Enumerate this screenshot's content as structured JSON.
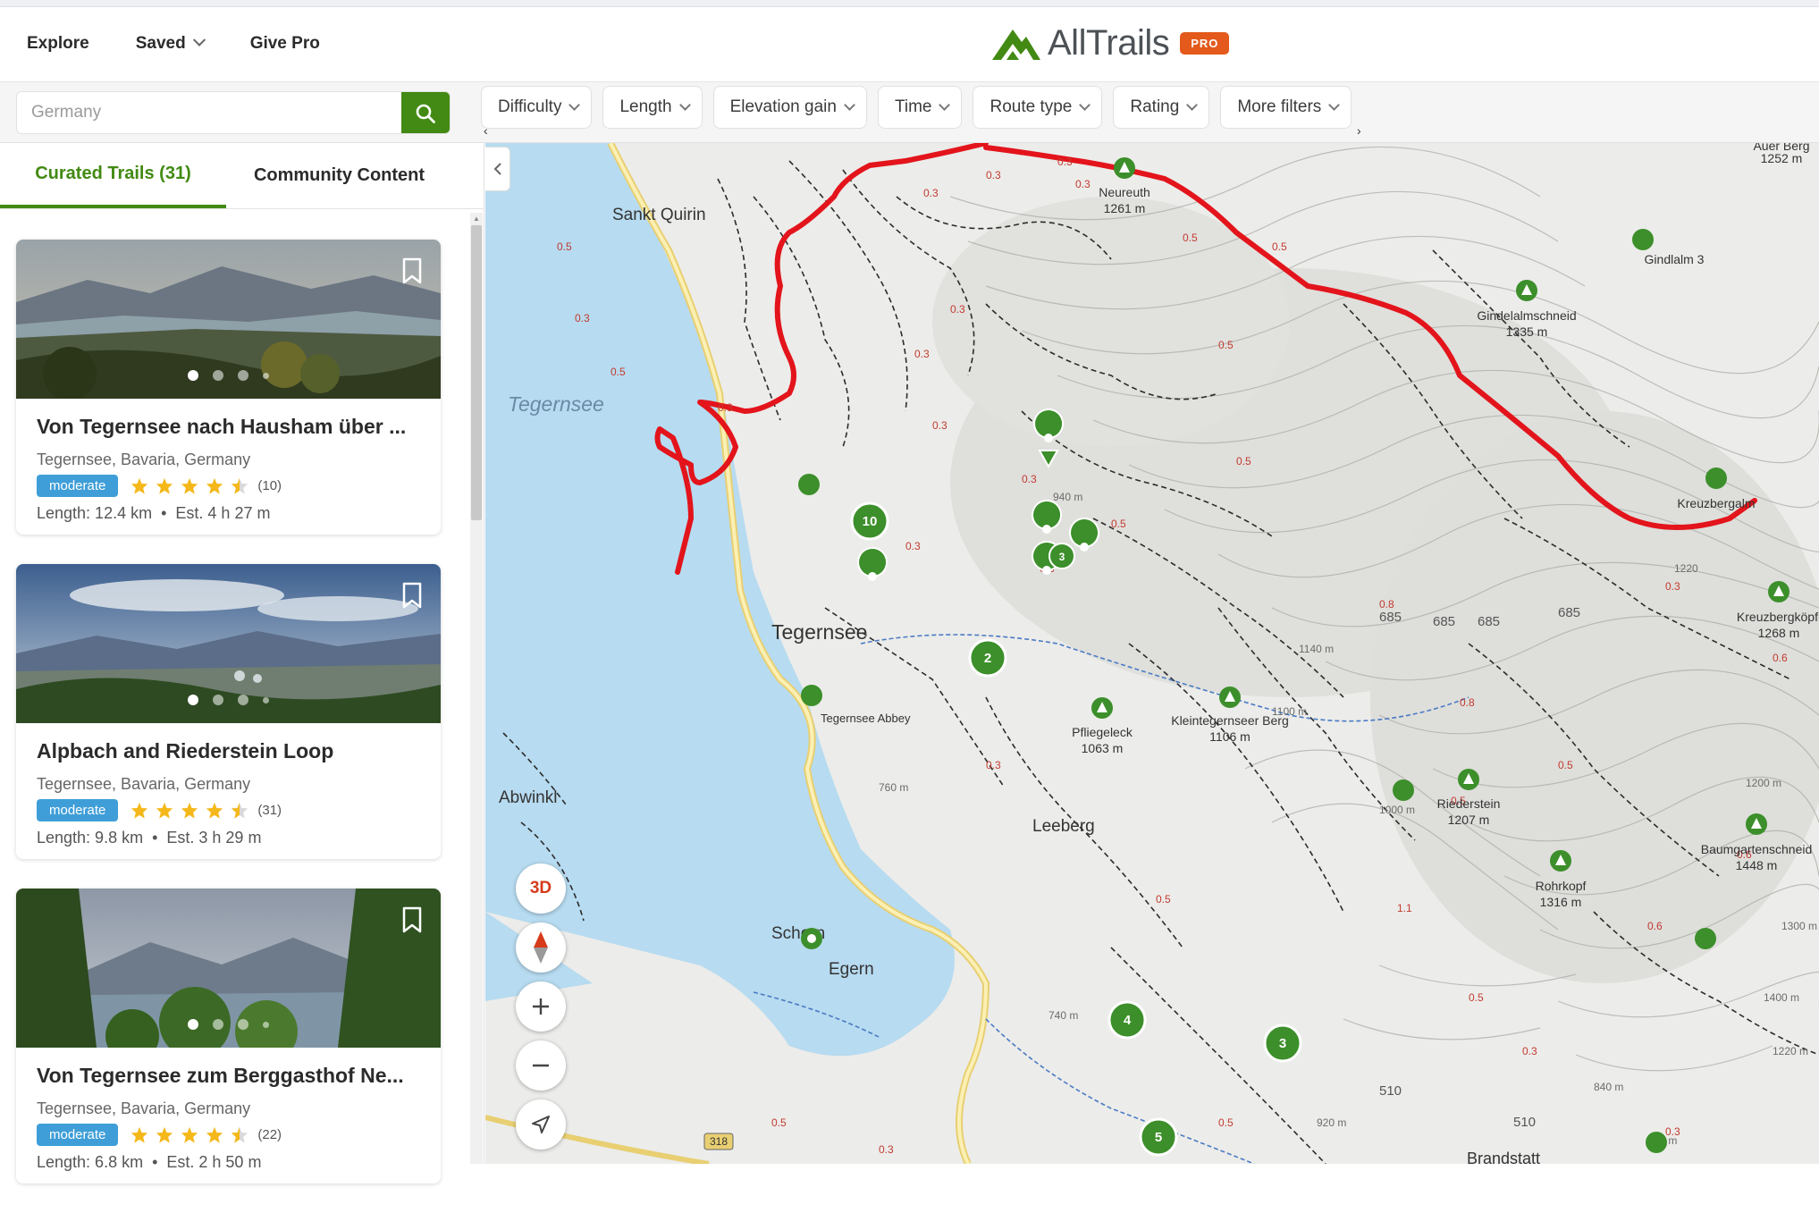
{
  "header": {
    "nav": [
      {
        "label": "Explore",
        "has_dropdown": false
      },
      {
        "label": "Saved",
        "has_dropdown": true
      },
      {
        "label": "Give Pro",
        "has_dropdown": false
      }
    ],
    "logo_text": "AllTrails",
    "pro_badge": "PRO"
  },
  "search": {
    "placeholder": "Germany"
  },
  "filters": [
    "Difficulty",
    "Length",
    "Elevation gain",
    "Time",
    "Route type",
    "Rating",
    "More filters"
  ],
  "tabs": [
    {
      "label": "Curated Trails (31)",
      "active": true
    },
    {
      "label": "Community Content",
      "active": false
    }
  ],
  "trails": [
    {
      "title": "Von Tegernsee nach Hausham über ...",
      "location": "Tegernsee, Bavaria, Germany",
      "difficulty": "moderate",
      "rating": 4.5,
      "reviews": "(10)",
      "length": "Length: 12.4 km",
      "time": "Est. 4 h 27 m"
    },
    {
      "title": "Alpbach and Riederstein Loop",
      "location": "Tegernsee, Bavaria, Germany",
      "difficulty": "moderate",
      "rating": 4.5,
      "reviews": "(31)",
      "length": "Length: 9.8 km",
      "time": "Est. 3 h 29 m"
    },
    {
      "title": "Von Tegernsee zum Berggasthof Ne...",
      "location": "Tegernsee, Bavaria, Germany",
      "difficulty": "moderate",
      "rating": 4.5,
      "reviews": "(22)",
      "length": "Length: 6.8 km",
      "time": "Est. 2 h 50 m"
    }
  ],
  "map": {
    "places": [
      "Sankt Quirin",
      "Tegernsee",
      "Tegernsee",
      "Tegernsee Abbey",
      "Abwinkl",
      "Leeberg",
      "Schorn",
      "Egern",
      "Brandstatt"
    ],
    "peaks": [
      {
        "name": "Neureuth",
        "elev": "1261 m"
      },
      {
        "name": "Gindelalmschneid",
        "elev": "1335 m"
      },
      {
        "name": "Gindlalm 3",
        "elev": ""
      },
      {
        "name": "Kreuzbergalm",
        "elev": ""
      },
      {
        "name": "Kreuzbergköpfl",
        "elev": "1268 m"
      },
      {
        "name": "Pfliegeleck",
        "elev": "1063 m"
      },
      {
        "name": "Kleintegernseer Berg",
        "elev": "1106 m"
      },
      {
        "name": "Riederstein",
        "elev": "1207 m"
      },
      {
        "name": "Rohrkopf",
        "elev": "1316 m"
      },
      {
        "name": "Baumgartenschneid",
        "elev": "1448 m"
      },
      {
        "name": "Auer Berg",
        "elev": "1252 m"
      }
    ],
    "clusters": [
      "10",
      "2",
      "4",
      "3",
      "5",
      "3"
    ],
    "road_number": "318",
    "controls": {
      "three_d": "3D"
    },
    "accent_red": "#e3141b",
    "brand_green": "#428a13"
  }
}
